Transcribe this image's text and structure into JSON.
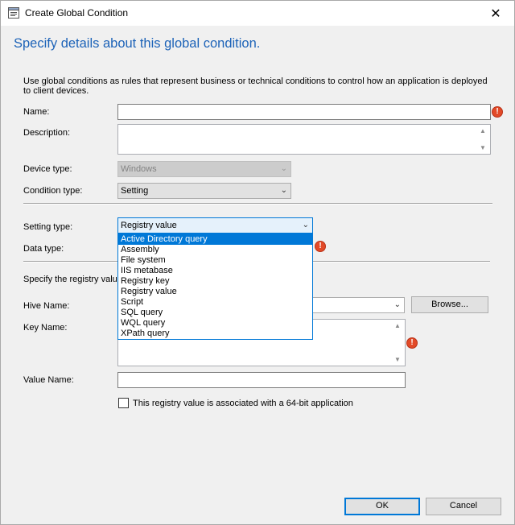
{
  "window": {
    "title": "Create Global Condition",
    "close_glyph": "✕",
    "icon": "dialog-window-icon"
  },
  "heading": "Specify details about this global condition.",
  "intro": "Use global conditions as rules that represent business or technical conditions to control how an application is deployed to client devices.",
  "form": {
    "name_label": "Name:",
    "name_value": "",
    "description_label": "Description:",
    "description_value": "",
    "device_type_label": "Device type:",
    "device_type_value": "Windows",
    "condition_type_label": "Condition type:",
    "condition_type_value": "Setting",
    "setting_type_label": "Setting type:",
    "setting_type_value": "Registry value",
    "data_type_label": "Data type:",
    "registry_section_label": "Specify the registry value",
    "hive_name_label": "Hive Name:",
    "hive_name_value": "",
    "browse_label": "Browse...",
    "key_name_label": "Key Name:",
    "key_name_value": "",
    "value_name_label": "Value Name:",
    "value_name_value": "",
    "checkbox_64bit_label": "This registry value is associated with a 64-bit application",
    "checkbox_64bit_checked": false,
    "error_glyph": "!"
  },
  "setting_type_options": [
    "Active Directory query",
    "Assembly",
    "File system",
    "IIS metabase",
    "Registry key",
    "Registry value",
    "Script",
    "SQL query",
    "WQL query",
    "XPath query"
  ],
  "setting_type_highlighted_index": 0,
  "footer": {
    "ok_label": "OK",
    "cancel_label": "Cancel"
  },
  "colors": {
    "heading": "#1d63b8",
    "accent": "#0078d7",
    "error": "#e24a28"
  }
}
